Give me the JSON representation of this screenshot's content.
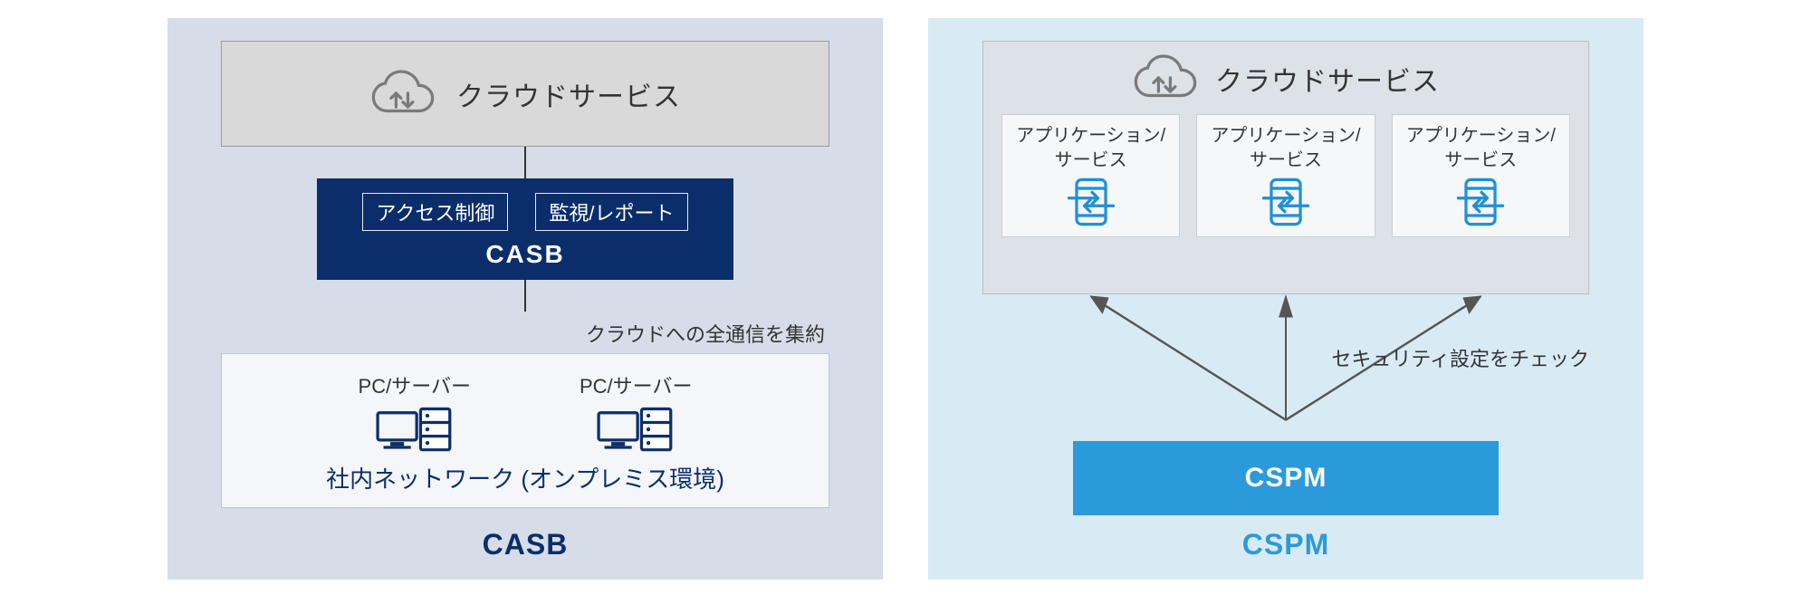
{
  "colors": {
    "casb_bg": "#d6dde8",
    "cspm_bg": "#d8ebf5",
    "navy": "#0b2e6b",
    "blue": "#2b9adb"
  },
  "casb": {
    "cloud_title": "クラウドサービス",
    "tags": {
      "access": "アクセス制御",
      "report": "監視/レポート"
    },
    "label": "CASB",
    "aggregate_note": "クラウドへの全通信を集約",
    "pc1": "PC/サーバー",
    "pc2": "PC/サーバー",
    "onprem_caption": "社内ネットワーク (オンプレミス環境)",
    "footer": "CASB"
  },
  "cspm": {
    "cloud_title": "クラウドサービス",
    "apps": [
      "アプリケーション/\nサービス",
      "アプリケーション/\nサービス",
      "アプリケーション/\nサービス"
    ],
    "check_note": "セキュリティ設定をチェック",
    "box_label": "CSPM",
    "footer": "CSPM"
  }
}
